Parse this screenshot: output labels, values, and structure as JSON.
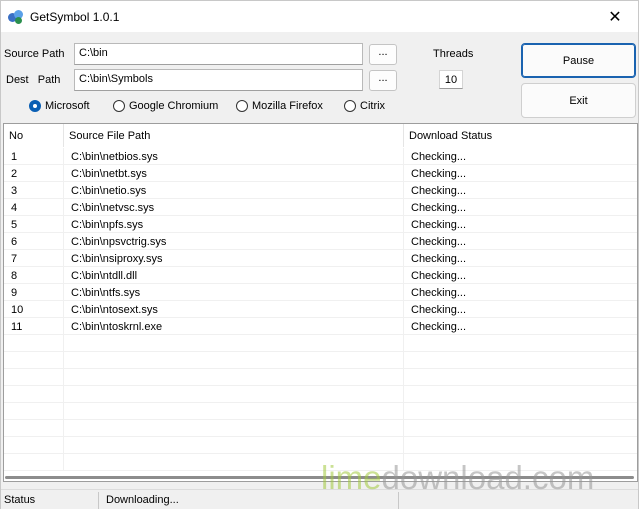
{
  "window": {
    "title": "GetSymbol 1.0.1",
    "close_glyph": "✕"
  },
  "form": {
    "source_label": "Source Path",
    "source_value": "C:\\bin",
    "dest_label": "Dest   Path",
    "dest_value": "C:\\bin\\Symbols",
    "browse_label": "...",
    "threads_label": "Threads",
    "threads_value": "10",
    "pause_label": "Pause",
    "exit_label": "Exit"
  },
  "symbol_servers": {
    "selected": "Microsoft",
    "options": [
      "Microsoft",
      "Google Chromium",
      "Mozilla Firefox",
      "Citrix"
    ]
  },
  "table": {
    "columns": [
      "No",
      "Source File Path",
      "Download Status"
    ],
    "rows": [
      [
        "1",
        "C:\\bin\\netbios.sys",
        "Checking..."
      ],
      [
        "2",
        "C:\\bin\\netbt.sys",
        "Checking..."
      ],
      [
        "3",
        "C:\\bin\\netio.sys",
        "Checking..."
      ],
      [
        "4",
        "C:\\bin\\netvsc.sys",
        "Checking..."
      ],
      [
        "5",
        "C:\\bin\\npfs.sys",
        "Checking..."
      ],
      [
        "6",
        "C:\\bin\\npsvctrig.sys",
        "Checking..."
      ],
      [
        "7",
        "C:\\bin\\nsiproxy.sys",
        "Checking..."
      ],
      [
        "8",
        "C:\\bin\\ntdll.dll",
        "Checking..."
      ],
      [
        "9",
        "C:\\bin\\ntfs.sys",
        "Checking..."
      ],
      [
        "10",
        "C:\\bin\\ntosext.sys",
        "Checking..."
      ],
      [
        "11",
        "C:\\bin\\ntoskrnl.exe",
        "Checking..."
      ]
    ]
  },
  "statusbar": {
    "label": "Status",
    "value": "Downloading..."
  },
  "watermark": {
    "lime": "lime",
    "rest": "download.com"
  },
  "colors": {
    "accent": "#0a5fb4",
    "default_button_border": "#1a63b0",
    "watermark_green": "#a0c83c"
  },
  "icons": {
    "app": "app-icon",
    "close": "close-icon"
  }
}
